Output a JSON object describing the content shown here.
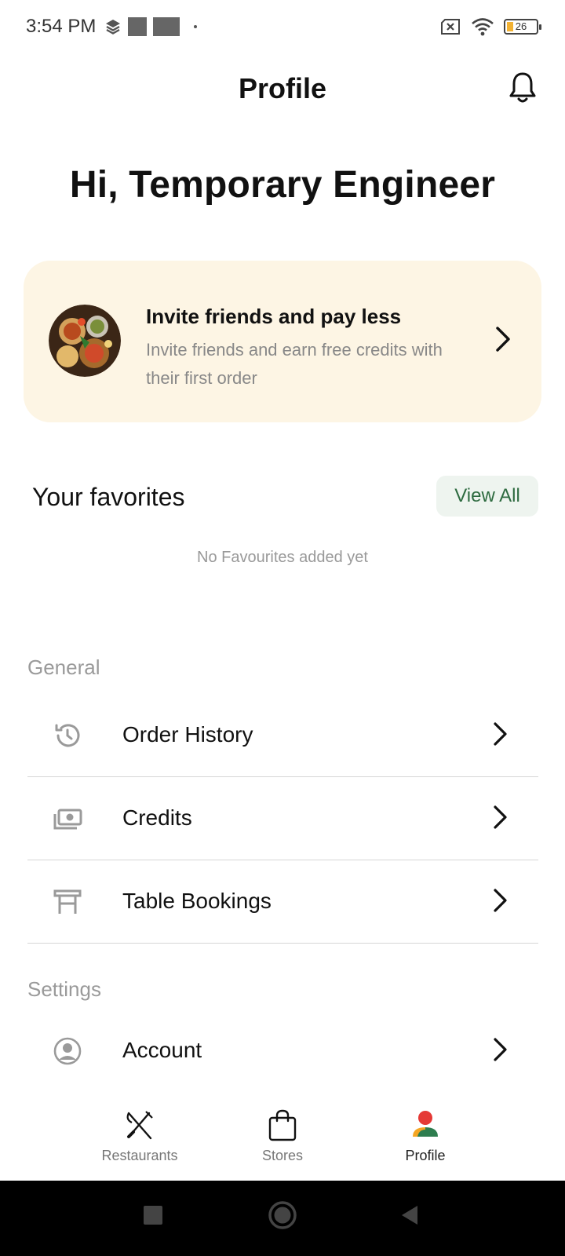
{
  "status_bar": {
    "time": "3:54 PM",
    "battery_level": "26"
  },
  "header": {
    "title": "Profile",
    "bell_icon": "bell-icon"
  },
  "greeting": "Hi, Temporary Engineer",
  "invite": {
    "title": "Invite friends and pay less",
    "subtitle": "Invite friends and earn free credits with their first order"
  },
  "favorites": {
    "title": "Your favorites",
    "view_all_label": "View All",
    "empty_text": "No Favourites added yet"
  },
  "general": {
    "label": "General",
    "items": [
      {
        "label": "Order History",
        "icon": "history-icon"
      },
      {
        "label": "Credits",
        "icon": "money-icon"
      },
      {
        "label": "Table Bookings",
        "icon": "table-icon"
      }
    ]
  },
  "settings": {
    "label": "Settings",
    "items": [
      {
        "label": "Account",
        "icon": "user-circle-icon"
      }
    ]
  },
  "tabbar": {
    "tabs": [
      {
        "label": "Restaurants",
        "icon": "fork-knife-icon",
        "active": false
      },
      {
        "label": "Stores",
        "icon": "shopping-bag-icon",
        "active": false
      },
      {
        "label": "Profile",
        "icon": "profile-icon",
        "active": true
      }
    ]
  },
  "colors": {
    "accent_green": "#2e6b40",
    "invite_bg": "#fdf5e4",
    "profile_red": "#e53935",
    "profile_orange": "#f5a623",
    "profile_green": "#2e7d4f"
  }
}
